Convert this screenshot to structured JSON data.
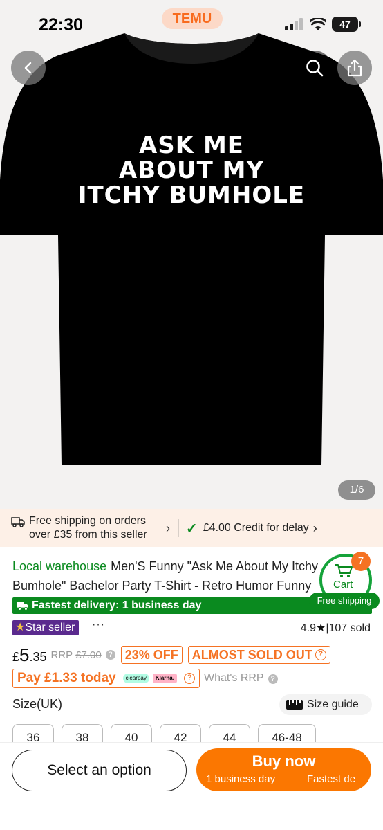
{
  "status_bar": {
    "time": "22:30",
    "battery": "47"
  },
  "brand": {
    "logo": "TEMU"
  },
  "product_image": {
    "shirt_lines": [
      "ASK ME",
      "ABOUT MY",
      "ITCHY BUMHOLE"
    ],
    "counter": "1/6"
  },
  "shipping_banner": {
    "line1": "Free shipping on orders",
    "line2": "over £35 from this seller",
    "credit": "£4.00 Credit for delay"
  },
  "product": {
    "local_tag": "Local warehouse",
    "title_line1": "Men'S Funny \"Ask Me About My Itchy",
    "title_line2": "Bumhole\" Bachelor Party T-Shirt - Retro Humor Funny",
    "fastest_delivery": "Fastest delivery: 1 business day",
    "star_seller": "Star seller",
    "more": "···",
    "rating": "4.9",
    "sold": "|107 sold"
  },
  "price": {
    "currency": "£",
    "whole": "5",
    "cents": ".35",
    "rrp_label": "RRP",
    "rrp_value": "£7.00",
    "discount": "23% OFF",
    "almost_sold_out": "ALMOST SOLD OUT",
    "pay_today": "Pay £1.33 today",
    "clearpay": "clearpay",
    "klarna": "Klarna.",
    "whats_rrp": "What's RRP"
  },
  "size": {
    "label": "Size(UK)",
    "guide": "Size guide",
    "options": [
      "36",
      "38",
      "40",
      "42",
      "44",
      "46-48"
    ]
  },
  "cart": {
    "label": "Cart",
    "count": "7",
    "free_shipping": "Free shipping"
  },
  "actions": {
    "select_option": "Select an option",
    "buy_now": "Buy now",
    "buy_sub1": "1 business day",
    "buy_sub2": "Fastest de"
  },
  "colors": {
    "temu_orange": "#fb7701",
    "green": "#0a8a1f",
    "star_purple": "#5a2a8e"
  }
}
